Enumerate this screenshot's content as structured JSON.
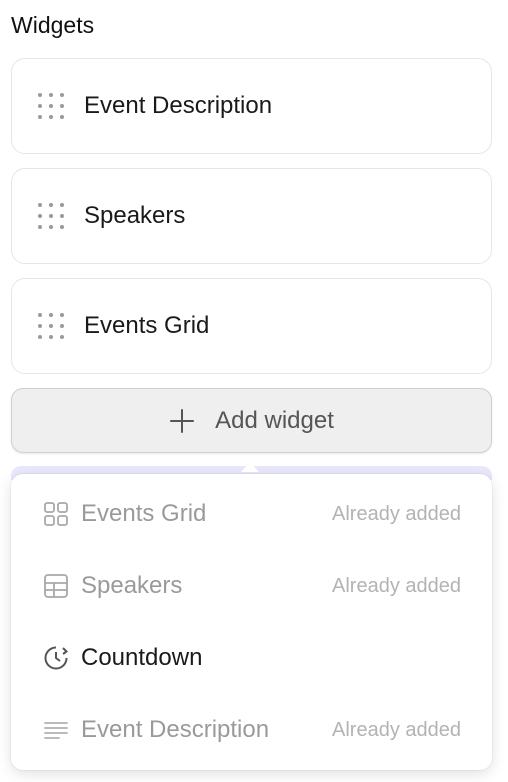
{
  "section": {
    "title": "Widgets"
  },
  "widgets": [
    {
      "label": "Event Description"
    },
    {
      "label": "Speakers"
    },
    {
      "label": "Events Grid"
    }
  ],
  "add_button": {
    "label": "Add widget",
    "icon": "plus-icon"
  },
  "dropdown": {
    "options": [
      {
        "label": "Events Grid",
        "note": "Already added",
        "icon": "grid-icon",
        "disabled": true
      },
      {
        "label": "Speakers",
        "note": "Already added",
        "icon": "table-icon",
        "disabled": true
      },
      {
        "label": "Countdown",
        "note": "",
        "icon": "clock-icon",
        "disabled": false
      },
      {
        "label": "Event Description",
        "note": "Already added",
        "icon": "text-lines-icon",
        "disabled": true
      }
    ]
  },
  "colors": {
    "accent_tint": "#e9e8fb",
    "muted_text": "#9a9a9a",
    "note_text": "#b3b3b3",
    "button_bg": "#efefef"
  }
}
